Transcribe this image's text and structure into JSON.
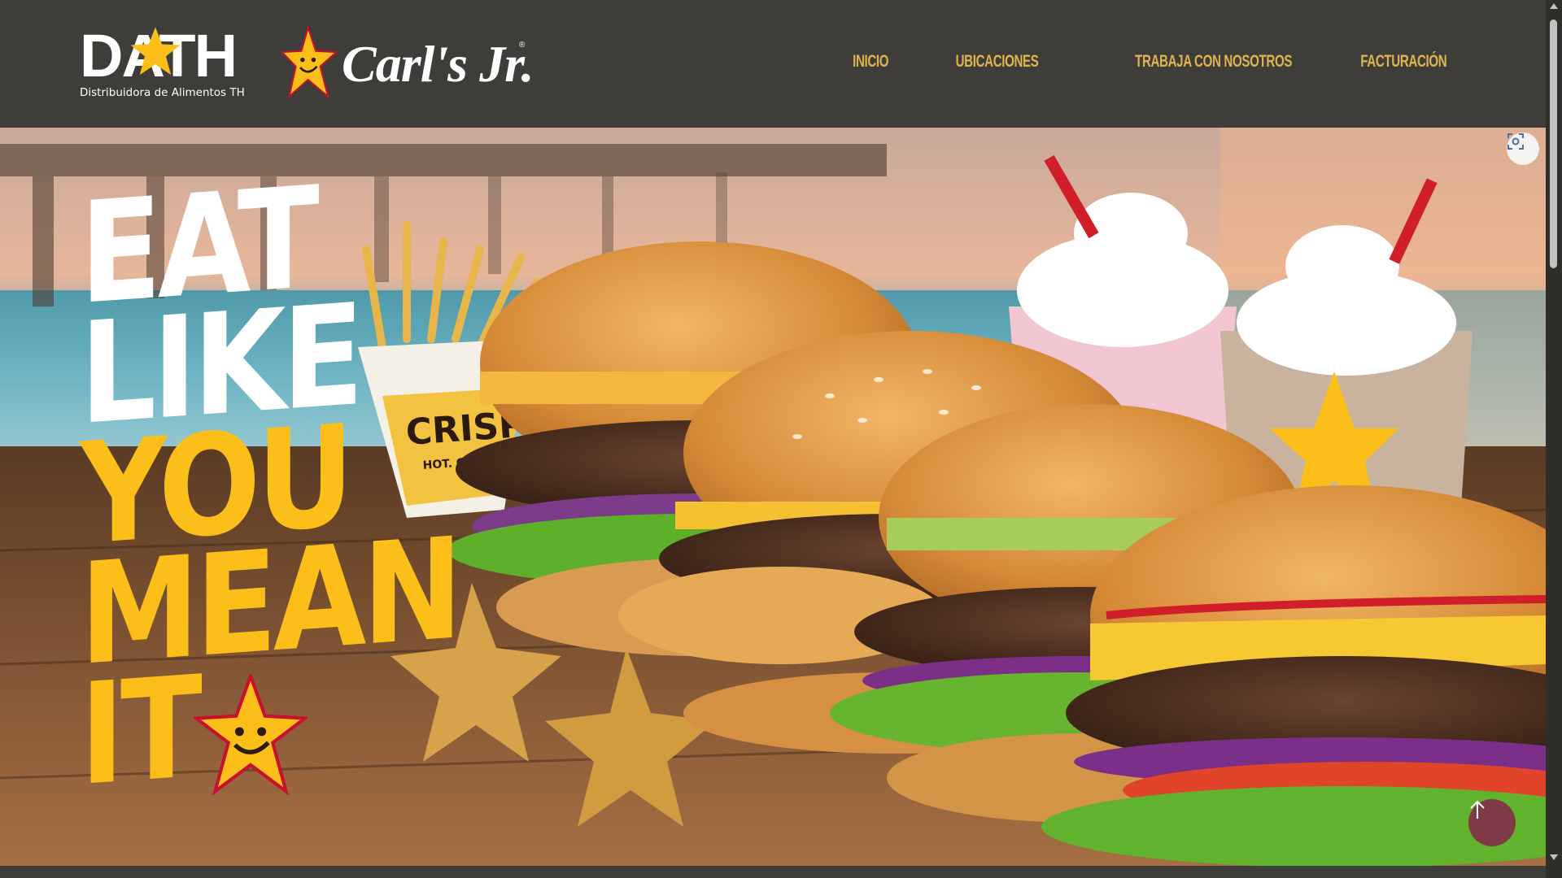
{
  "header": {
    "dath_logo_text": "DATH",
    "dath_logo_subtitle": "Distribuidora de Alimentos TH",
    "brand_logo_text": "Carl's Jr.",
    "brand_logo_reg": "®",
    "nav": [
      {
        "label": "Inicio"
      },
      {
        "label": "Ubicaciones"
      },
      {
        "label": "Trabaja con nosotros"
      },
      {
        "label": "Facturación"
      }
    ]
  },
  "hero": {
    "slogan": [
      "EAT",
      "LIKE",
      "YOU",
      "MEAN",
      "IT"
    ],
    "fries_box_label": "CRISP",
    "fries_box_sublabel": "HOT. CRUNCH"
  },
  "colors": {
    "header_bg": "#3f3d3a",
    "nav_text": "#dcb44e",
    "brand_yellow": "#fcbf1a",
    "scroll_top_button": "#7e3b45"
  },
  "icons": {
    "lens": "visual-search-icon",
    "scroll_top": "arrow-up-icon"
  }
}
